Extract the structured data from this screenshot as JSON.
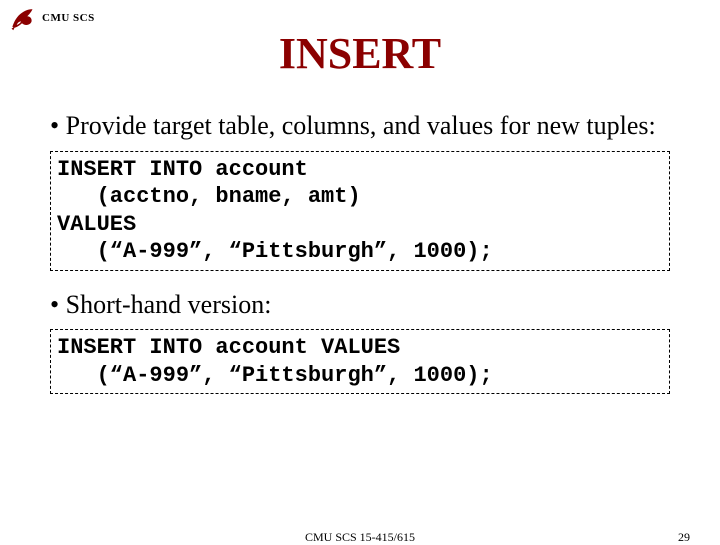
{
  "header": {
    "org_label": "CMU SCS"
  },
  "title": "INSERT",
  "bullets": {
    "b1": "Provide target table, columns, and values for new tuples:",
    "b2": "Short-hand version:"
  },
  "code": {
    "block1": "INSERT INTO account\n   (acctno, bname, amt)\nVALUES\n   (“A-999”, “Pittsburgh”, 1000);",
    "block2": "INSERT INTO account VALUES\n   (“A-999”, “Pittsburgh”, 1000);"
  },
  "footer": {
    "center": "CMU SCS 15-415/615",
    "page": "29"
  },
  "colors": {
    "title": "#8B0000",
    "logo": "#8B0000"
  }
}
